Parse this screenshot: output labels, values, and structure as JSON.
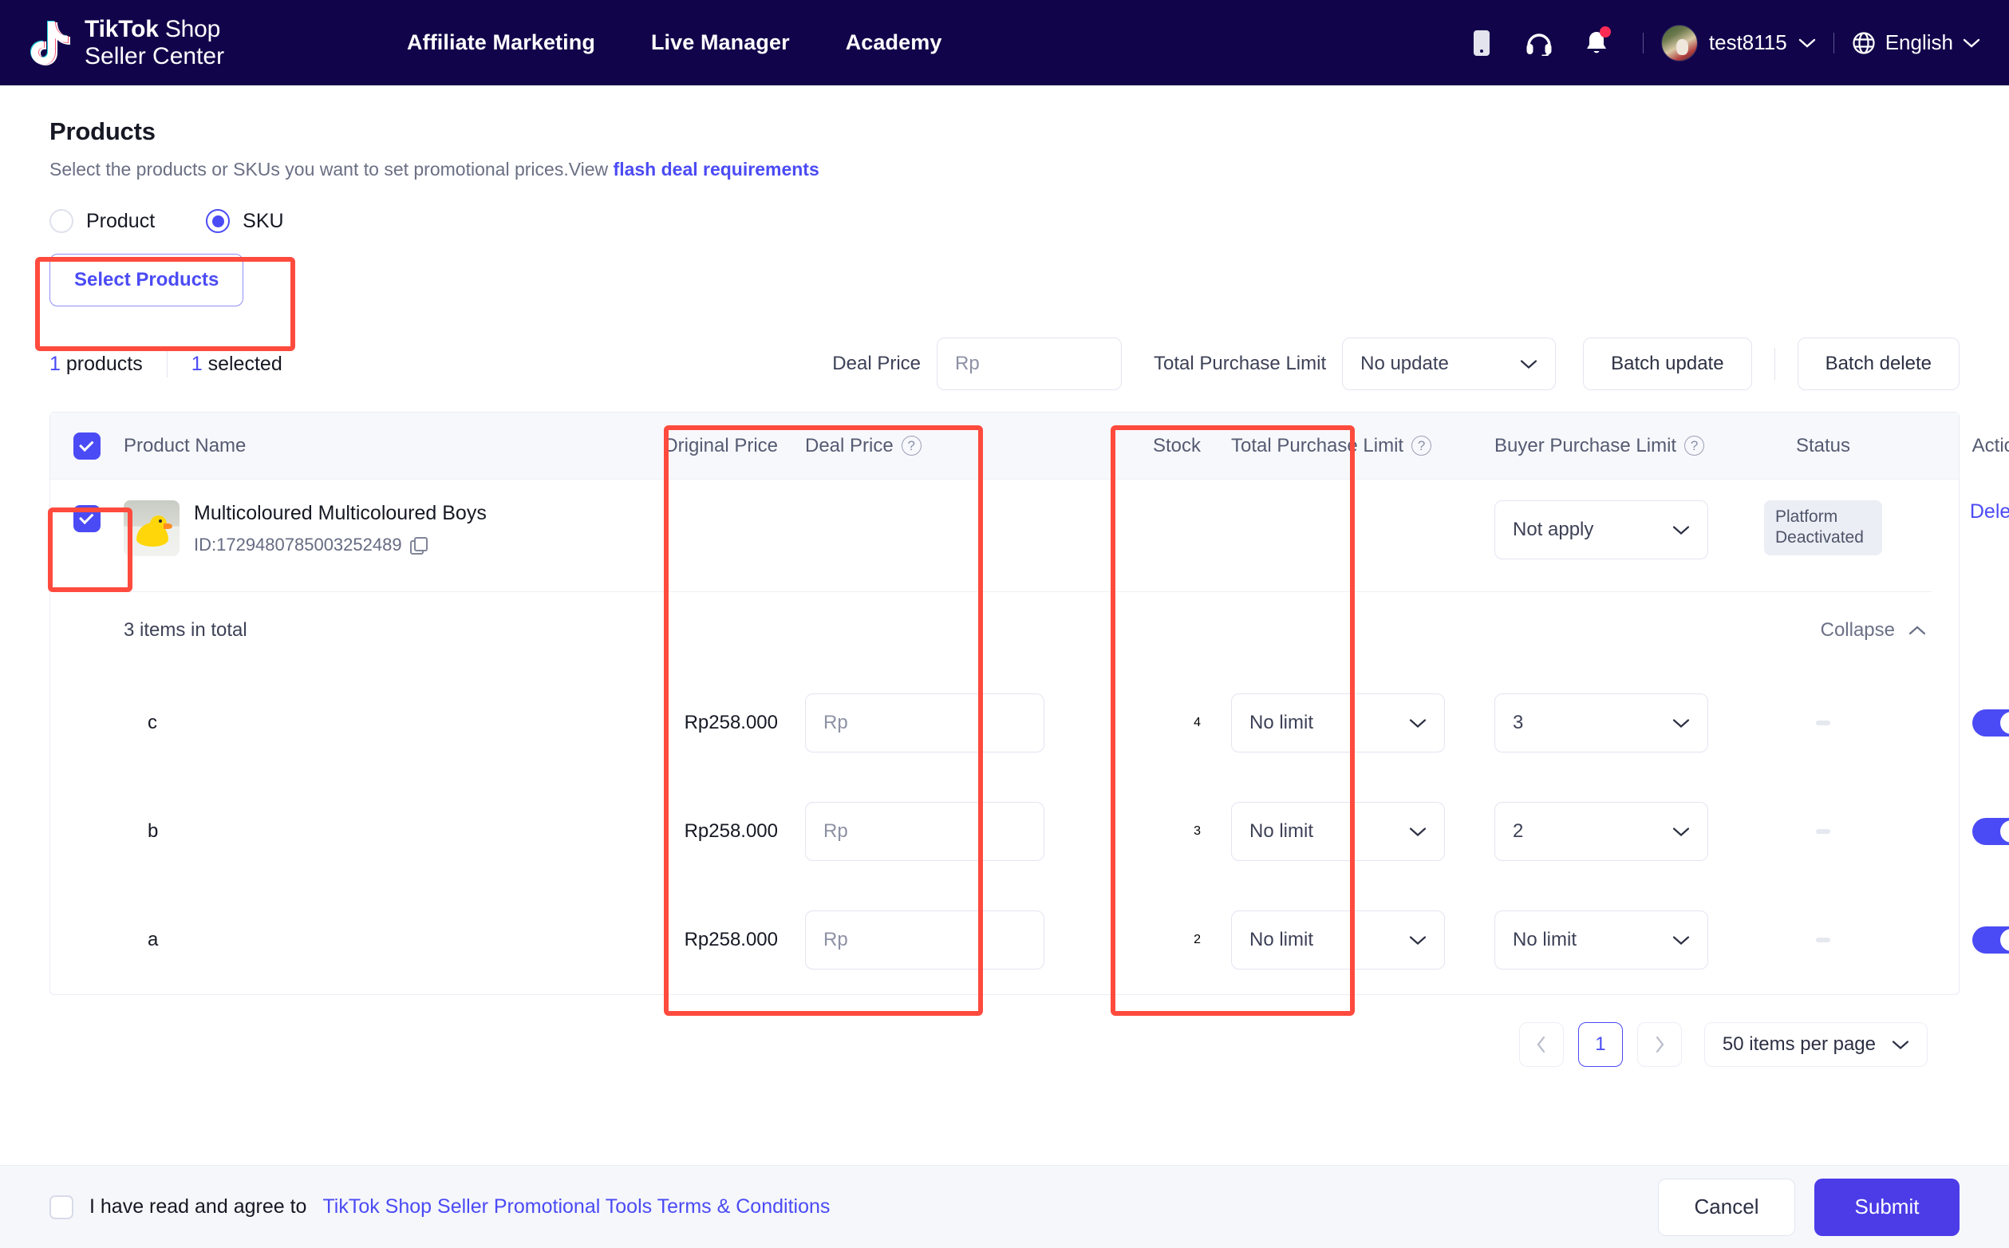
{
  "header": {
    "logo_line1_bold": "TikTok",
    "logo_line1_rest": " Shop",
    "logo_line2": "Seller Center",
    "nav": [
      {
        "label": "Affiliate Marketing"
      },
      {
        "label": "Live Manager"
      },
      {
        "label": "Academy"
      }
    ],
    "icons": [
      "mobile-icon",
      "headset-icon",
      "bell-icon"
    ],
    "user": "test8115",
    "language": "English"
  },
  "page": {
    "title": "Products",
    "subtitle_text": "Select the products or SKUs you want to set promotional prices.View ",
    "subtitle_link": "flash deal requirements"
  },
  "scope": {
    "options": [
      {
        "label": "Product",
        "selected": false
      },
      {
        "label": "SKU",
        "selected": true
      }
    ]
  },
  "select_products_button": "Select Products",
  "toolbar": {
    "product_count": "1",
    "product_count_label": " products",
    "selected_count": "1",
    "selected_count_label": " selected",
    "deal_price_label": "Deal Price",
    "deal_price_placeholder": "Rp",
    "deal_price_value": "Rp",
    "total_purchase_limit_label": "Total Purchase Limit",
    "total_purchase_limit_value": "No update",
    "batch_update": "Batch update",
    "batch_delete": "Batch delete"
  },
  "table": {
    "headers": {
      "product_name": "Product Name",
      "original_price": "Original Price",
      "deal_price": "Deal Price",
      "stock": "Stock",
      "total_purchase_limit": "Total Purchase Limit",
      "buyer_purchase_limit": "Buyer Purchase Limit",
      "status": "Status",
      "action": "Action"
    },
    "select_all_checked": true,
    "product": {
      "checked": true,
      "name": "Multicoloured Multicoloured Boys",
      "id": "ID:1729480785003252489",
      "buyer_purchase_limit": "Not apply",
      "status": "Platform Deactivated",
      "action": "Delete"
    },
    "sku_group": {
      "total_label": "3 items in total",
      "collapse_label": "Collapse"
    },
    "skus": [
      {
        "name": "c",
        "original_price": "Rp258.000",
        "deal_price_placeholder": "Rp",
        "stock": "4",
        "total_purchase_limit": "No limit",
        "buyer_purchase_limit": "3",
        "status": "-",
        "enabled": true
      },
      {
        "name": "b",
        "original_price": "Rp258.000",
        "deal_price_placeholder": "Rp",
        "stock": "3",
        "total_purchase_limit": "No limit",
        "buyer_purchase_limit": "2",
        "status": "-",
        "enabled": true
      },
      {
        "name": "a",
        "original_price": "Rp258.000",
        "deal_price_placeholder": "Rp",
        "stock": "2",
        "total_purchase_limit": "No limit",
        "buyer_purchase_limit": "No limit",
        "status": "-",
        "enabled": true
      }
    ]
  },
  "pagination": {
    "current_page": "1",
    "page_size": "50 items per page"
  },
  "footer": {
    "agree_text": "I have read and agree to",
    "agree_link": "TikTok Shop Seller Promotional Tools Terms & Conditions",
    "agree_checked": false,
    "cancel": "Cancel",
    "submit": "Submit"
  },
  "colors": {
    "brand_dark": "#12044a",
    "accent": "#4b4bf5",
    "submit": "#4b3ce8",
    "annotation": "#ff4b3e",
    "badge_bg": "#eceef5"
  }
}
